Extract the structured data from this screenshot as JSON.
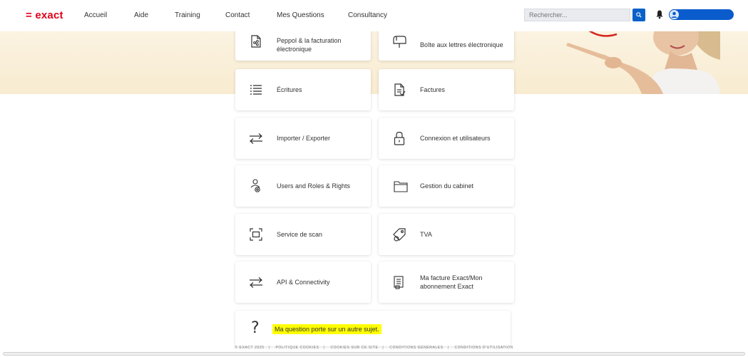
{
  "header": {
    "logo": "= exact",
    "nav": [
      "Accueil",
      "Aide",
      "Training",
      "Contact",
      "Mes Questions",
      "Consultancy"
    ],
    "search_placeholder": "Rechercher..."
  },
  "tiles": [
    {
      "label": "Peppol & la facturation électronique",
      "icon": "document-share-icon"
    },
    {
      "label": "Boîte aux lettres électronique",
      "icon": "mailbox-icon"
    },
    {
      "label": "Écritures",
      "icon": "list-icon"
    },
    {
      "label": "Factures",
      "icon": "invoice-icon"
    },
    {
      "label": "Importer / Exporter",
      "icon": "arrows-swap-icon"
    },
    {
      "label": "Connexion et utilisateurs",
      "icon": "lock-icon"
    },
    {
      "label": "Users and Roles & Rights",
      "icon": "user-roles-icon"
    },
    {
      "label": "Gestion du cabinet",
      "icon": "folder-icon"
    },
    {
      "label": "Service de scan",
      "icon": "scan-icon"
    },
    {
      "label": "TVA",
      "icon": "tag-icon"
    },
    {
      "label": "API & Connectivity",
      "icon": "arrows-swap-icon"
    },
    {
      "label": "Ma facture Exact/Mon abonnement Exact",
      "icon": "invoice-subscription-icon"
    }
  ],
  "other_question": {
    "icon": "question-icon",
    "label": "Ma question porte sur un autre sujet."
  },
  "footer": {
    "copyright": "© EXACT 2025",
    "links": [
      "POLITIQUE COOKIES",
      "COOKIES SUR CE SITE",
      "CONDITIONS GÉNÉRALES",
      "CONDITIONS D'UTILISATION"
    ]
  },
  "colors": {
    "brand": "#e2001a",
    "primary": "#0a5ccc",
    "highlight": "#ffff00",
    "hero": "#fbf3e1"
  }
}
